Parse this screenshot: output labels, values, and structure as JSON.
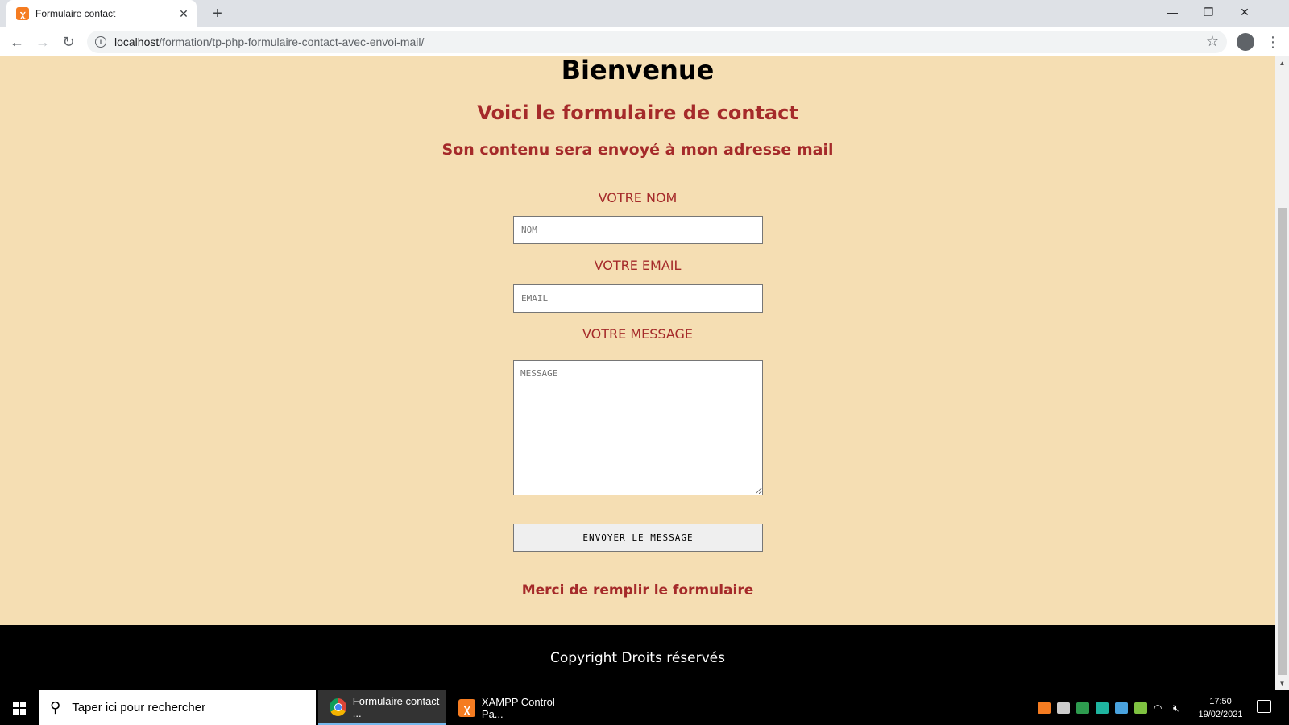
{
  "browser": {
    "tab_title": "Formulaire contact",
    "url_host": "localhost",
    "url_path": "/formation/tp-php-formulaire-contact-avec-envoi-mail/"
  },
  "page": {
    "heading": "Bienvenue",
    "subheading": "Voici le formulaire de contact",
    "subsubheading": "Son contenu sera envoyé à mon adresse mail",
    "form": {
      "name_label": "VOTRE NOM",
      "name_placeholder": "NOM",
      "email_label": "VOTRE EMAIL",
      "email_placeholder": "EMAIL",
      "message_label": "VOTRE MESSAGE",
      "message_placeholder": "MESSAGE",
      "submit_label": "ENVOYER LE MESSAGE"
    },
    "thanks_text": "Merci de remplir le formulaire",
    "footer_text": "Copyright Droits réservés"
  },
  "taskbar": {
    "search_placeholder": "Taper ici pour rechercher",
    "apps": [
      {
        "label": "Formulaire contact ...",
        "icon": "chrome-icon",
        "active": true
      },
      {
        "label": "XAMPP Control Pa...",
        "icon": "xampp-icon",
        "active": false
      }
    ],
    "time": "17:50",
    "date": "19/02/2021"
  },
  "colors": {
    "page_background": "#f5deb3",
    "accent_text": "#a52a2a",
    "footer_background": "#000000"
  }
}
